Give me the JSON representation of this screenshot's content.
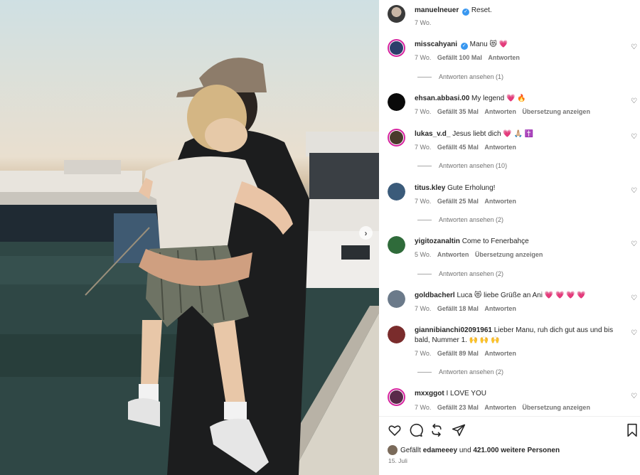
{
  "post": {
    "author": "manuelneuer",
    "caption": "Reset.",
    "time": "7 Wo."
  },
  "comments": [
    {
      "user": "misscahyani",
      "verified": true,
      "text": "Manu 😻 💗",
      "time": "7 Wo.",
      "likes": "Gefällt 100 Mal",
      "reply": "Antworten",
      "translate": "",
      "view_replies": "Antworten ansehen (1)",
      "avatar_color": "#2c3e6b"
    },
    {
      "user": "ehsan.abbasi.00",
      "verified": false,
      "text": "My legend 💗 🔥",
      "time": "7 Wo.",
      "likes": "Gefällt 35 Mal",
      "reply": "Antworten",
      "translate": "Übersetzung anzeigen",
      "view_replies": "",
      "avatar_color": "#0a0a0a"
    },
    {
      "user": "lukas_v.d_",
      "verified": false,
      "text": "Jesus liebt dich 💗 🙏🏼 ✝️",
      "time": "7 Wo.",
      "likes": "Gefällt 45 Mal",
      "reply": "Antworten",
      "translate": "",
      "view_replies": "Antworten ansehen (10)",
      "avatar_color": "#4a3b2c"
    },
    {
      "user": "titus.kley",
      "verified": false,
      "text": "Gute Erholung!",
      "time": "7 Wo.",
      "likes": "Gefällt 25 Mal",
      "reply": "Antworten",
      "translate": "",
      "view_replies": "Antworten ansehen (2)",
      "avatar_color": "#3b5b7a"
    },
    {
      "user": "yigitozanaltin",
      "verified": false,
      "text": "Come to Fenerbahçe",
      "time": "5 Wo.",
      "likes": "",
      "reply": "Antworten",
      "translate": "Übersetzung anzeigen",
      "view_replies": "Antworten ansehen (2)",
      "avatar_color": "#2f6b3a"
    },
    {
      "user": "goldbacherl",
      "verified": false,
      "text": "Luca 😻 liebe Grüße an Ani 💗 💗 💗 💗",
      "time": "7 Wo.",
      "likes": "Gefällt 18 Mal",
      "reply": "Antworten",
      "translate": "",
      "view_replies": "",
      "avatar_color": "#6b7a8a"
    },
    {
      "user": "giannibianchi02091961",
      "verified": false,
      "text": "Lieber Manu, ruh dich gut aus und bis bald, Nummer 1. 🙌 🙌 🙌",
      "time": "7 Wo.",
      "likes": "Gefällt 89 Mal",
      "reply": "Antworten",
      "translate": "",
      "view_replies": "Antworten ansehen (2)",
      "avatar_color": "#7a2c2c"
    },
    {
      "user": "mxxggot",
      "verified": false,
      "text": "I LOVE YOU",
      "time": "7 Wo.",
      "likes": "Gefällt 23 Mal",
      "reply": "Antworten",
      "translate": "Übersetzung anzeigen",
      "view_replies": "",
      "avatar_color": "#5a2a4a"
    }
  ],
  "likes": {
    "prefix": "Gefällt",
    "user": "edameeey",
    "middle": "und",
    "count": "421.000 weitere Personen"
  },
  "date": "15. Juli",
  "icons": {
    "like": "heart-outline-icon",
    "comment": "comment-bubble-icon",
    "share": "repost-icon",
    "send": "paper-plane-icon",
    "save": "bookmark-icon",
    "next": "chevron-right-icon",
    "verified": "verified-badge-icon"
  },
  "colors": {
    "verified": "#3897f0",
    "story_ring": "#d6249f",
    "muted_text": "#737373",
    "heart": "#ed4956"
  }
}
